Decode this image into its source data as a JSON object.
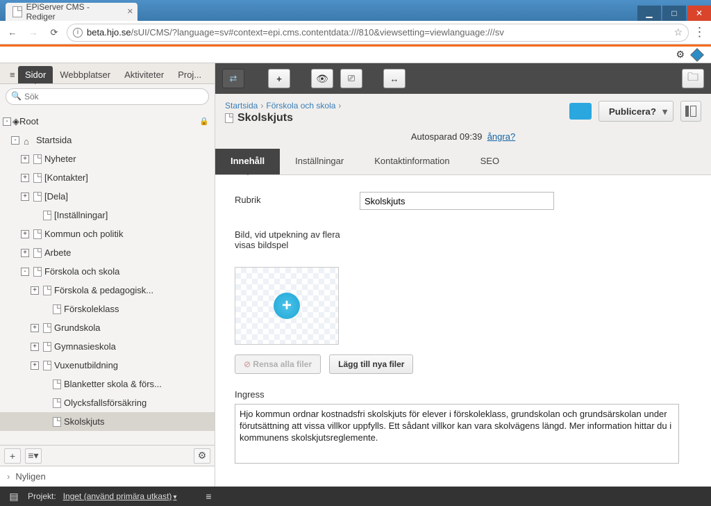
{
  "browser": {
    "tab_title": "EPiServer CMS - Rediger",
    "url_host": "beta.hjo.se",
    "url_path": "/sUI/CMS/?language=sv#context=epi.cms.contentdata:///810&viewsetting=viewlanguage:///sv"
  },
  "sidebar": {
    "tabs": [
      "Sidor",
      "Webbplatser",
      "Aktiviteter",
      "Proj..."
    ],
    "search_placeholder": "Sök",
    "root_label": "Root",
    "tree": [
      {
        "label": "Startsida",
        "indent": 1,
        "icon": "home",
        "toggle": "-"
      },
      {
        "label": "Nyheter",
        "indent": 2,
        "icon": "page",
        "toggle": "+"
      },
      {
        "label": "[Kontakter]",
        "indent": 2,
        "icon": "page",
        "toggle": "+"
      },
      {
        "label": "[Dela]",
        "indent": 2,
        "icon": "page",
        "toggle": "+"
      },
      {
        "label": "[Inställningar]",
        "indent": 3,
        "icon": "page",
        "toggle": " "
      },
      {
        "label": "Kommun och politik",
        "indent": 2,
        "icon": "page",
        "toggle": "+"
      },
      {
        "label": "Arbete",
        "indent": 2,
        "icon": "page",
        "toggle": "+"
      },
      {
        "label": "Förskola och skola",
        "indent": 2,
        "icon": "page",
        "toggle": "-"
      },
      {
        "label": "Förskola & pedagogisk...",
        "indent": 3,
        "icon": "page",
        "toggle": "+"
      },
      {
        "label": "Förskoleklass",
        "indent": 4,
        "icon": "page",
        "toggle": " "
      },
      {
        "label": "Grundskola",
        "indent": 3,
        "icon": "page",
        "toggle": "+"
      },
      {
        "label": "Gymnasieskola",
        "indent": 3,
        "icon": "page",
        "toggle": "+"
      },
      {
        "label": "Vuxenutbildning",
        "indent": 3,
        "icon": "page",
        "toggle": "+"
      },
      {
        "label": "Blanketter skola & förs...",
        "indent": 4,
        "icon": "page",
        "toggle": " "
      },
      {
        "label": "Olycksfallsförsäkring",
        "indent": 4,
        "icon": "page",
        "toggle": " "
      },
      {
        "label": "Skolskjuts",
        "indent": 4,
        "icon": "page",
        "toggle": " ",
        "selected": true
      }
    ],
    "recent_label": "Nyligen"
  },
  "content": {
    "breadcrumbs": [
      "Startsida",
      "Förskola och skola"
    ],
    "page_title": "Skolskjuts",
    "publish_label": "Publicera?",
    "autosave_prefix": "Autosparad ",
    "autosave_time": "09:39",
    "undo": "ångra?",
    "tabs": [
      "Innehåll",
      "Inställningar",
      "Kontaktinformation",
      "SEO"
    ],
    "fields": {
      "heading_label": "Rubrik",
      "heading_value": "Skolskjuts",
      "image_label": "Bild, vid utpekning av flera visas bildspel",
      "clear_files": "Rensa alla filer",
      "add_files": "Lägg till nya filer",
      "ingress_label": "Ingress",
      "ingress_value": "Hjo kommun ordnar kostnadsfri skolskjuts för elever i förskoleklass, grundskolan och grundsärskolan under förutsättning att vissa villkor uppfylls. Ett sådant villkor kan vara skolvägens längd. Mer information hittar du i kommunens skolskjutsreglemente."
    }
  },
  "footer": {
    "project_label": "Projekt:",
    "project_value": "Inget (använd primära utkast)"
  }
}
